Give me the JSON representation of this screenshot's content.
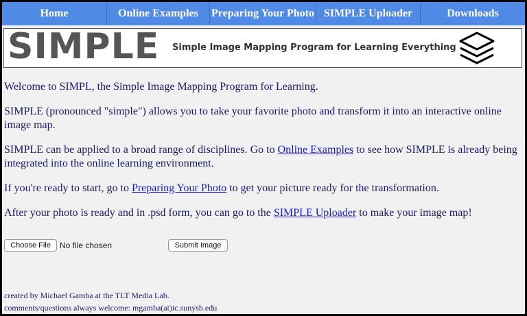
{
  "nav": {
    "items": [
      "Home",
      "Online Examples",
      "Preparing Your Photo",
      "SIMPLE Uploader",
      "Downloads"
    ]
  },
  "header": {
    "logo": "SIMPLE",
    "tagline": "Simple Image Mapping Program for Learning Everything",
    "icon": "layers-icon"
  },
  "content": {
    "p1": "Welcome to SIMPL, the Simple Image Mapping Program for Learning.",
    "p2": "SIMPLE (pronounced \"simple\") allows you to take your favorite photo and transform it into an interactive online image map.",
    "p3_before": "SIMPLE can be applied to a broad range of disciplines. Go to ",
    "p3_link": "Online Examples",
    "p3_after": " to see how SIMPLE is already being integrated into the online learning environment.",
    "p4_before": "If you're ready to start, go to ",
    "p4_link": "Preparing Your Photo",
    "p4_after": " to get your picture ready for the transformation.",
    "p5_before": "After your photo is ready and in .psd form, you can go to the ",
    "p5_link": "SIMPLE Uploader",
    "p5_after": " to make your image map!"
  },
  "form": {
    "choose_file": "Choose File",
    "no_file": "No file chosen",
    "submit": "Submit Image"
  },
  "footer": {
    "credit": "created by Michael Gamba at the TLT Media Lab.",
    "contact": "comments/questions always welcome: mgamba(at)ic.sunysb.edu"
  },
  "colors": {
    "nav_bg": "#4f8ae6",
    "text": "#1a1a6a",
    "link": "#1a1ad6"
  }
}
